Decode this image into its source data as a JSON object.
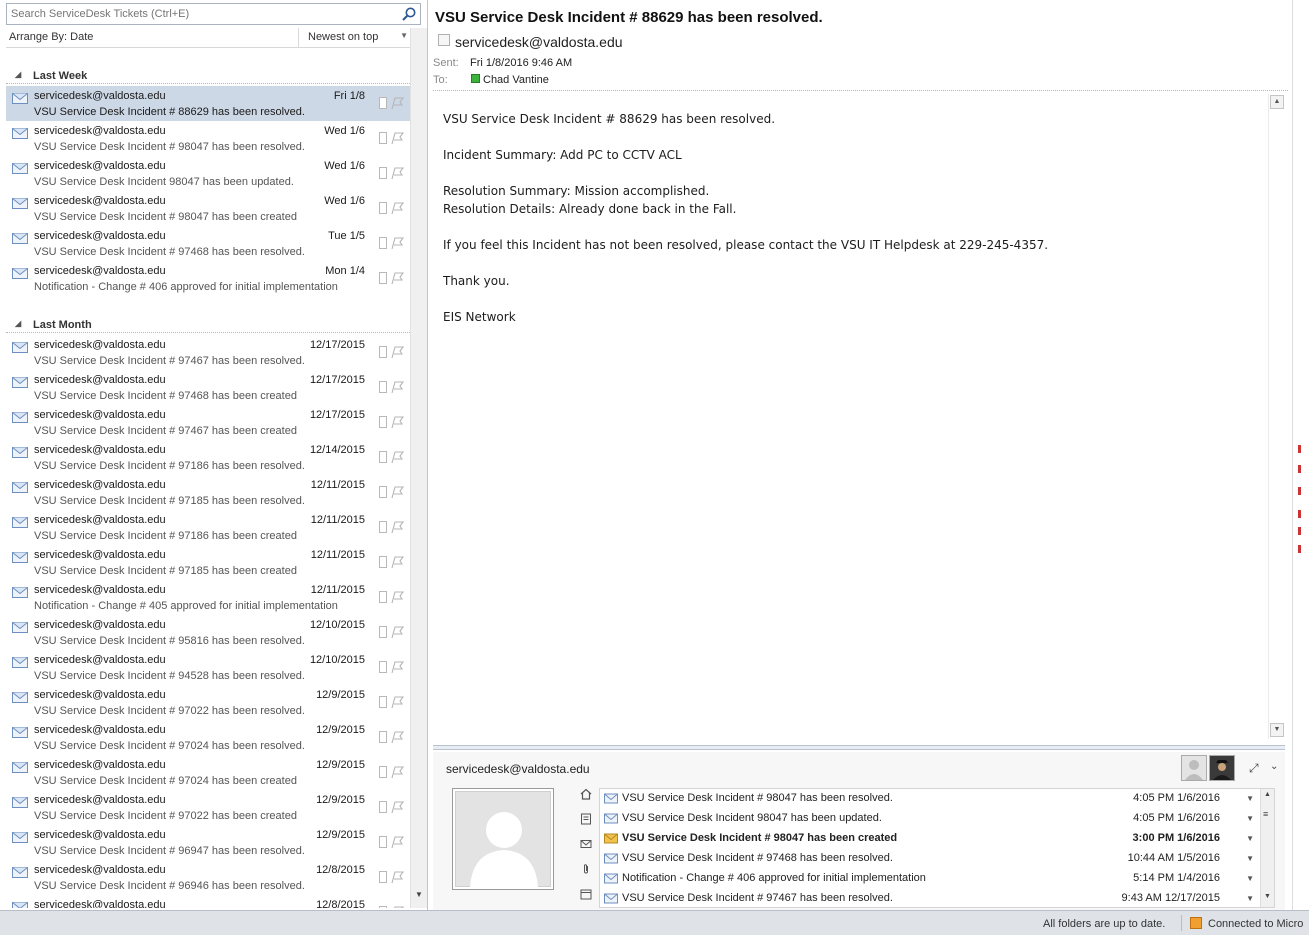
{
  "search": {
    "placeholder": "Search ServiceDesk Tickets (Ctrl+E)"
  },
  "arrange": {
    "by_label": "Arrange By: Date",
    "order_label": "Newest on top"
  },
  "groups": [
    {
      "label": "Last Week",
      "items": [
        {
          "from": "servicedesk@valdosta.edu",
          "subject": "VSU Service Desk Incident # 88629 has been resolved.",
          "date": "Fri 1/8",
          "selected": true
        },
        {
          "from": "servicedesk@valdosta.edu",
          "subject": "VSU Service Desk Incident # 98047 has been resolved.",
          "date": "Wed 1/6"
        },
        {
          "from": "servicedesk@valdosta.edu",
          "subject": "VSU Service Desk Incident 98047 has been updated.",
          "date": "Wed 1/6"
        },
        {
          "from": "servicedesk@valdosta.edu",
          "subject": "VSU Service Desk Incident # 98047 has been created",
          "date": "Wed 1/6"
        },
        {
          "from": "servicedesk@valdosta.edu",
          "subject": "VSU Service Desk Incident # 97468 has been resolved.",
          "date": "Tue 1/5"
        },
        {
          "from": "servicedesk@valdosta.edu",
          "subject": "Notification - Change # 406 approved for initial implementation",
          "date": "Mon 1/4"
        }
      ]
    },
    {
      "label": "Last Month",
      "items": [
        {
          "from": "servicedesk@valdosta.edu",
          "subject": "VSU Service Desk Incident # 97467 has been resolved.",
          "date": "12/17/2015"
        },
        {
          "from": "servicedesk@valdosta.edu",
          "subject": "VSU Service Desk Incident # 97468 has been created",
          "date": "12/17/2015"
        },
        {
          "from": "servicedesk@valdosta.edu",
          "subject": "VSU Service Desk Incident # 97467 has been created",
          "date": "12/17/2015"
        },
        {
          "from": "servicedesk@valdosta.edu",
          "subject": "VSU Service Desk Incident # 97186 has been resolved.",
          "date": "12/14/2015"
        },
        {
          "from": "servicedesk@valdosta.edu",
          "subject": "VSU Service Desk Incident # 97185 has been resolved.",
          "date": "12/11/2015"
        },
        {
          "from": "servicedesk@valdosta.edu",
          "subject": "VSU Service Desk Incident # 97186 has been created",
          "date": "12/11/2015"
        },
        {
          "from": "servicedesk@valdosta.edu",
          "subject": "VSU Service Desk Incident # 97185 has been created",
          "date": "12/11/2015"
        },
        {
          "from": "servicedesk@valdosta.edu",
          "subject": "Notification - Change # 405 approved for initial implementation",
          "date": "12/11/2015"
        },
        {
          "from": "servicedesk@valdosta.edu",
          "subject": "VSU Service Desk Incident # 95816 has been resolved.",
          "date": "12/10/2015"
        },
        {
          "from": "servicedesk@valdosta.edu",
          "subject": "VSU Service Desk Incident # 94528 has been resolved.",
          "date": "12/10/2015"
        },
        {
          "from": "servicedesk@valdosta.edu",
          "subject": "VSU Service Desk Incident # 97022 has been resolved.",
          "date": "12/9/2015"
        },
        {
          "from": "servicedesk@valdosta.edu",
          "subject": "VSU Service Desk Incident # 97024 has been resolved.",
          "date": "12/9/2015"
        },
        {
          "from": "servicedesk@valdosta.edu",
          "subject": "VSU Service Desk Incident # 97024 has been created",
          "date": "12/9/2015"
        },
        {
          "from": "servicedesk@valdosta.edu",
          "subject": "VSU Service Desk Incident # 97022 has been created",
          "date": "12/9/2015"
        },
        {
          "from": "servicedesk@valdosta.edu",
          "subject": "VSU Service Desk Incident # 96947 has been resolved.",
          "date": "12/9/2015"
        },
        {
          "from": "servicedesk@valdosta.edu",
          "subject": "VSU Service Desk Incident # 96946 has been resolved.",
          "date": "12/8/2015"
        },
        {
          "from": "servicedesk@valdosta.edu",
          "subject": "",
          "date": "12/8/2015"
        }
      ]
    }
  ],
  "message": {
    "title": "VSU Service Desk Incident # 88629 has been resolved.",
    "from": "servicedesk@valdosta.edu",
    "sent_label": "Sent:",
    "sent": "Fri 1/8/2016 9:46 AM",
    "to_label": "To:",
    "to": "Chad  Vantine",
    "body": {
      "line1": "VSU Service Desk Incident # 88629 has been resolved.",
      "line2": "Incident Summary: Add PC to CCTV ACL",
      "line3": "Resolution Summary: Mission accomplished.",
      "line4": "Resolution Details: Already done back in the Fall.",
      "line5": "If you feel this Incident has not been resolved, please contact the VSU IT Helpdesk at 229-245-4357.",
      "line6": "Thank you.",
      "line7": "EIS Network"
    }
  },
  "people_pane": {
    "name": "servicedesk@valdosta.edu",
    "rows": [
      {
        "subject": "VSU Service Desk Incident # 98047 has been resolved.",
        "time": "4:05 PM 1/6/2016",
        "unread": false
      },
      {
        "subject": "VSU Service Desk Incident 98047 has been updated.",
        "time": "4:05 PM 1/6/2016",
        "unread": false
      },
      {
        "subject": "VSU Service Desk Incident # 98047 has been created",
        "time": "3:00 PM 1/6/2016",
        "unread": true
      },
      {
        "subject": "VSU Service Desk Incident # 97468 has been resolved.",
        "time": "10:44 AM 1/5/2016",
        "unread": false
      },
      {
        "subject": "Notification - Change # 406 approved for initial implementation",
        "time": "5:14 PM 1/4/2016",
        "unread": false
      },
      {
        "subject": "VSU Service Desk Incident # 97467 has been resolved.",
        "time": "9:43 AM 12/17/2015",
        "unread": false
      }
    ]
  },
  "status": {
    "sync": "All folders are up to date.",
    "connection": "Connected to Micro"
  },
  "icons": {
    "envelope": "envelope-icon",
    "flag": "flag-icon",
    "search": "search-icon",
    "home": "home-icon",
    "mail": "mail-icon",
    "attachment": "paperclip-icon",
    "calendar": "calendar-icon"
  }
}
